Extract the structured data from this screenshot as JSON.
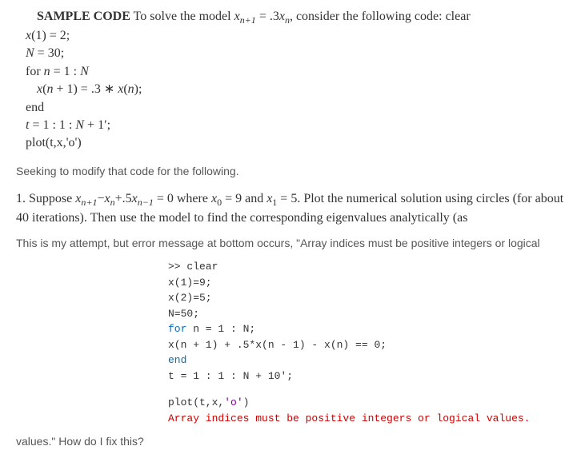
{
  "sample": {
    "heading": "SAMPLE CODE",
    "intro_a": " To solve the model ",
    "intro_eq_lhs_x": "x",
    "intro_eq_lhs_sub": "n+1",
    "intro_eq_mid": " = .3",
    "intro_eq_rhs_x": "x",
    "intro_eq_rhs_sub": "n",
    "intro_b": ", consider the following code: clear",
    "line1_a": "x",
    "line1_b": "(1) = 2;",
    "line2_a": "N",
    "line2_b": " = 30;",
    "line3_a": "for ",
    "line3_b": "n",
    "line3_c": " = 1 : ",
    "line3_d": "N",
    "line4_a": "x",
    "line4_b": "(",
    "line4_c": "n",
    "line4_d": " + 1) = .3 ∗ ",
    "line4_e": "x",
    "line4_f": "(",
    "line4_g": "n",
    "line4_h": ");",
    "line5": "end",
    "line6_a": "t",
    "line6_b": " = 1 : 1 : ",
    "line6_c": "N",
    "line6_d": " + 1′;",
    "line7": "plot(t,x,'o')"
  },
  "body1": "Seeking to modify that code for the following.",
  "problem": {
    "prefix": "1. Suppose ",
    "eq_x1": "x",
    "eq_sub1": "n+1",
    "eq_minus1": "−",
    "eq_x2": "x",
    "eq_sub2": "n",
    "eq_plus": "+.5",
    "eq_x3": "x",
    "eq_sub3": "n−1",
    "eq_eq0": " = 0 where ",
    "eq_x4": "x",
    "eq_sub4": "0",
    "eq_val4": " = 9 and ",
    "eq_x5": "x",
    "eq_sub5": "1",
    "eq_val5": " = 5.  Plot the numerical solution using circles (for about 40 iterations).  Then use the model to find the corresponding eigenvalues analytically (as"
  },
  "body2": "This is my attempt, but error message at bottom occurs, \"Array indices must be positive integers or logical",
  "matlab": {
    "l1": ">> clear",
    "l2": "x(1)=9;",
    "l3": "x(2)=5;",
    "l4": "N=50;",
    "l5_for": "for",
    "l5_rest": " n = 1 : N;",
    "l6": "x(n + 1) + .5*x(n - 1) - x(n) == 0;",
    "l7_end": "end",
    "l8": "t = 1 : 1 : N + 10';",
    "l10a": "plot(t,x,",
    "l10b": "'o'",
    "l10c": ")",
    "err": "Array indices must be positive integers or logical values."
  },
  "body3": "values.\" How do I fix this?"
}
